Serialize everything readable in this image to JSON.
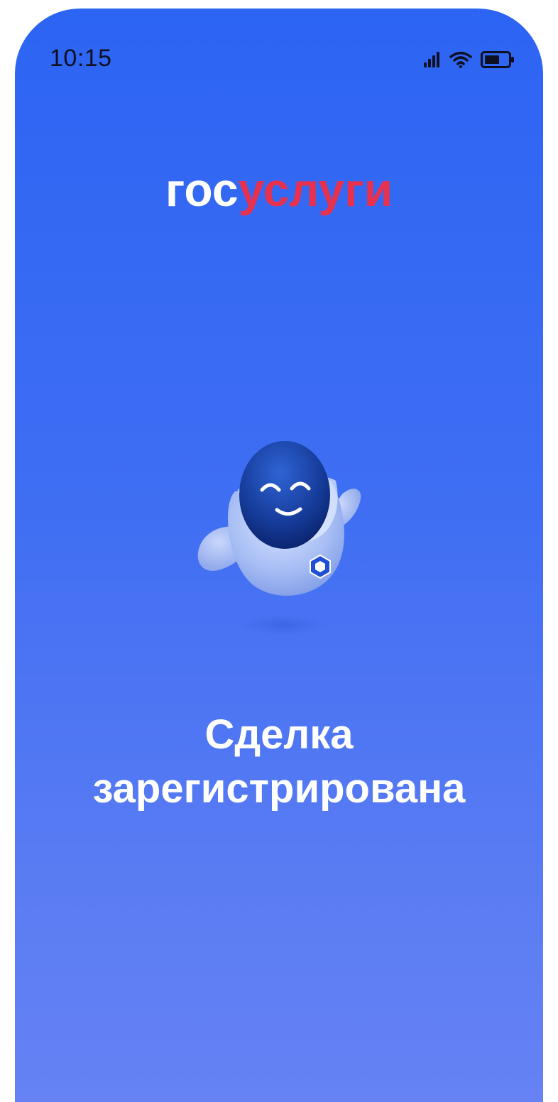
{
  "status_bar": {
    "time": "10:15",
    "icons": [
      "cellular-signal-icon",
      "wifi-icon",
      "battery-icon"
    ]
  },
  "logo": {
    "part1": "гос",
    "part2": "услуги"
  },
  "mascot": {
    "icon": "robot-mascot-icon"
  },
  "message": {
    "line1": "Сделка",
    "line2": "зарегистрирована"
  },
  "colors": {
    "background_top": "#2c64f3",
    "background_bottom": "#6682f4",
    "logo_accent": "#e8314f",
    "text": "#ffffff"
  }
}
